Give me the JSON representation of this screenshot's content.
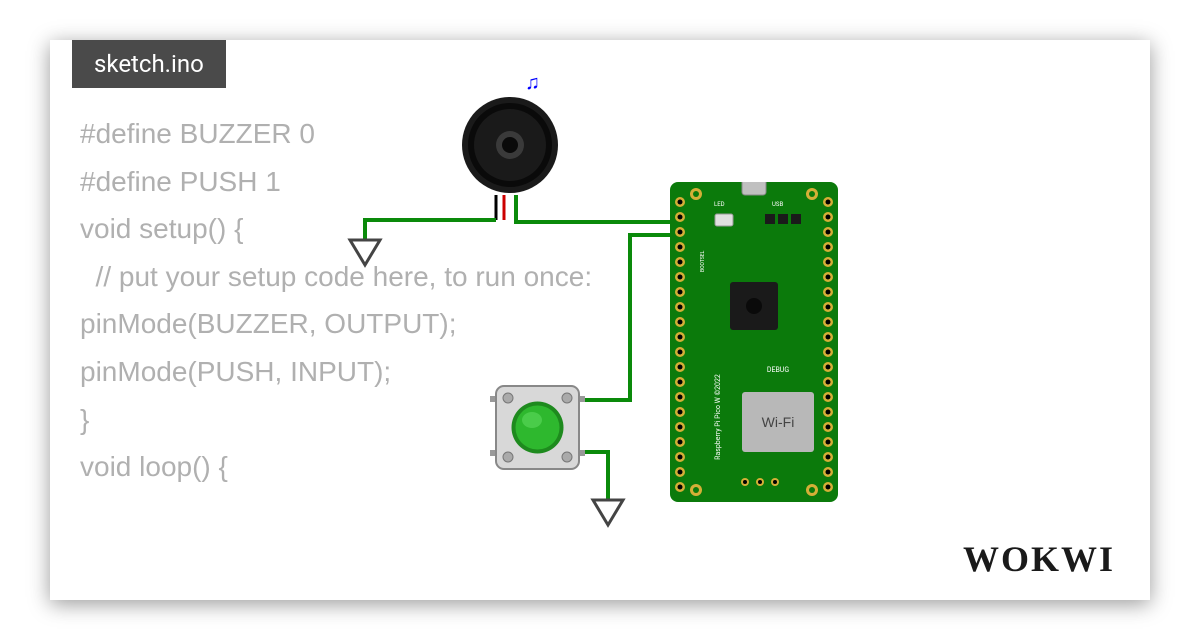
{
  "tab": {
    "filename": "sketch.ino"
  },
  "code": {
    "lines": [
      "#define BUZZER 0",
      "#define PUSH 1",
      "",
      "void setup() {",
      "  // put your setup code here, to run once:",
      "pinMode(BUZZER, OUTPUT);",
      "pinMode(PUSH, INPUT);",
      "}",
      "",
      "void loop() {"
    ]
  },
  "branding": {
    "logo": "WOKWI"
  },
  "components": {
    "board": {
      "name": "Raspberry Pi Pico W",
      "year": "©2022",
      "wifi_label": "Wi-Fi",
      "debug_label": "DEBUG",
      "led_label": "LED",
      "usb_label": "USB",
      "bootsel_label": "BOOTSEL"
    },
    "buzzer": {
      "type": "piezo-buzzer",
      "sound_icon": "♫"
    },
    "button": {
      "type": "push-button",
      "color": "green"
    }
  },
  "diagram": {
    "colors": {
      "wire_green": "#0a8a0a",
      "wire_red": "#cc0000",
      "pcb_green": "#0b7a0b",
      "button_green": "#2aa82a"
    }
  }
}
